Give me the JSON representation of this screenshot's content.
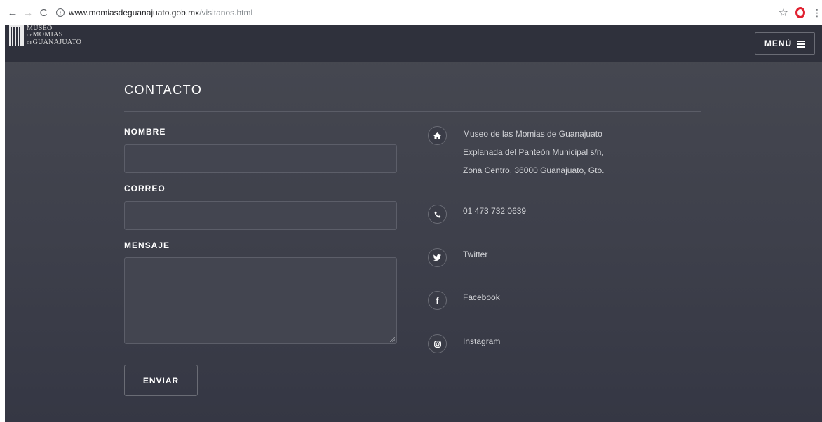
{
  "browser": {
    "back": "←",
    "forward": "→",
    "reload": "C",
    "info": "i",
    "url_host": "www.momiasdeguanajuato.gob.mx",
    "url_path": "/visitanos.html",
    "star": "☆",
    "kebab": "⋮"
  },
  "header": {
    "logo_line1": "MUSEO",
    "logo_line2_small": "DE",
    "logo_line2": "MOMIAS",
    "logo_line3_small": "DE",
    "logo_line3": "GUANAJUATO",
    "menu_label": "MENÚ"
  },
  "contact": {
    "title": "CONTACTO",
    "form": {
      "name_label": "NOMBRE",
      "name_value": "",
      "email_label": "CORREO",
      "email_value": "",
      "message_label": "MENSAJE",
      "message_value": "",
      "submit_label": "ENVIAR"
    },
    "info": {
      "address_lines": [
        "Museo de las Momias de Guanajuato",
        "Explanada del Panteón Municipal s/n,",
        "Zona Centro, 36000 Guanajuato, Gto."
      ],
      "phone": "01 473 732 0639",
      "twitter": "Twitter",
      "facebook": "Facebook",
      "instagram": "Instagram"
    }
  },
  "icons": {
    "address": "home-icon",
    "phone": "phone-icon",
    "twitter": "twitter-icon",
    "facebook": "facebook-icon",
    "instagram": "instagram-icon"
  },
  "colors": {
    "background": "#3e404b",
    "header": "#2f313c",
    "opera": "#e0202f"
  }
}
